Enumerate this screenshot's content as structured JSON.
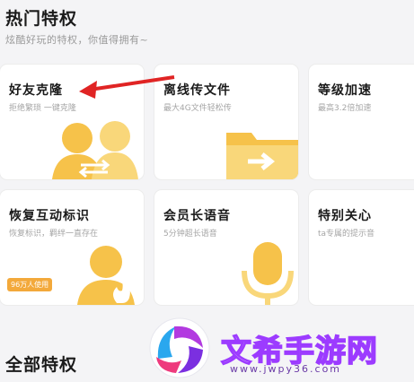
{
  "section": {
    "title": "热门特权",
    "subtitle": "炫酷好玩的特权，你值得拥有~"
  },
  "cards": [
    {
      "title": "好友克隆",
      "desc": "拒绝繁琐 一键克隆"
    },
    {
      "title": "离线传文件",
      "desc": "最大4G文件轻松传"
    },
    {
      "title": "等级加速",
      "desc": "最高3.2倍加速"
    },
    {
      "title": "恢复互动标识",
      "desc": "恢复标识，羁绊一直存在",
      "badge": "96万人使用"
    },
    {
      "title": "会员长语音",
      "desc": "5分钟超长语音"
    },
    {
      "title": "特别关心",
      "desc": "ta专属的提示音"
    }
  ],
  "all_section": {
    "title": "全部特权"
  },
  "watermark": {
    "text": "文希手游网",
    "url": "www.jwpy36.com"
  },
  "colors": {
    "accent_arrow": "#e02424",
    "art_gold": "#f6c24a",
    "badge": "#f3a93b"
  }
}
